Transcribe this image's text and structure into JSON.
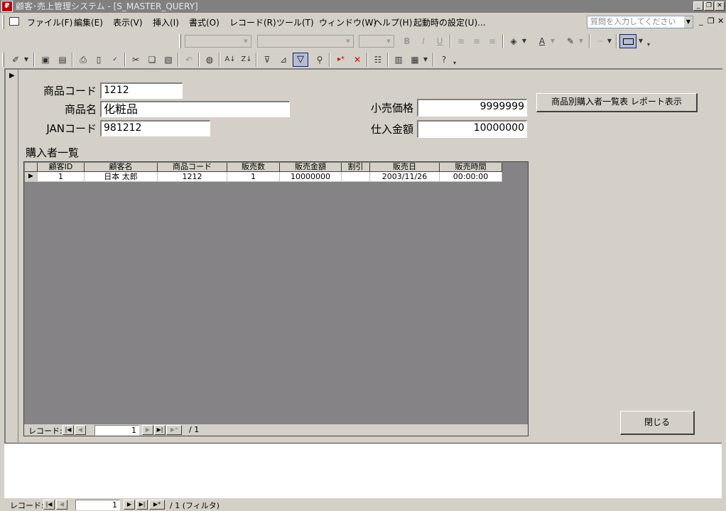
{
  "window": {
    "title": "顧客･売上管理システム - [S_MASTER_QUERY]",
    "app_icon_glyph": "₽"
  },
  "menubar": {
    "items": [
      "ファイル(F)",
      "編集(E)",
      "表示(V)",
      "挿入(I)",
      "書式(O)",
      "レコード(R)",
      "ツール(T)",
      "ウィンドウ(W)",
      "ヘルプ(H)",
      "起動時の設定(U)..."
    ],
    "help_placeholder": "質問を入力してください"
  },
  "toolbar": {
    "format_buttons": [
      "B",
      "I",
      "U"
    ]
  },
  "form": {
    "product_code_label": "商品コード",
    "product_code_value": "1212",
    "product_name_label": "商品名",
    "product_name_value": "化粧品",
    "jan_code_label": "JANコード",
    "jan_code_value": "981212",
    "retail_price_label": "小売価格",
    "retail_price_value": "9999999",
    "purchase_amount_label": "仕入金額",
    "purchase_amount_value": "10000000",
    "report_button_label": "商品別購入者一覧表 レポート表示",
    "buyers_section_label": "購入者一覧",
    "close_button_label": "閉じる"
  },
  "buyers_table": {
    "columns": [
      "顧客ID",
      "顧客名",
      "商品コード",
      "販売数",
      "販売金額",
      "割引",
      "販売日",
      "販売時間"
    ],
    "rows": [
      [
        "1",
        "日本 太郎",
        "1212",
        "1",
        "10000000",
        "",
        "2003/11/26",
        "00:00:00"
      ]
    ]
  },
  "sub_nav": {
    "label": "レコード:",
    "current": "1",
    "total": "/ 1"
  },
  "main_nav": {
    "label": "レコード:",
    "current": "1",
    "total": "/ 1 (フィルタ)"
  },
  "colors": {
    "title_bar": "#808080",
    "window_bg": "#d4d0c8",
    "subform_bg": "#858386"
  }
}
